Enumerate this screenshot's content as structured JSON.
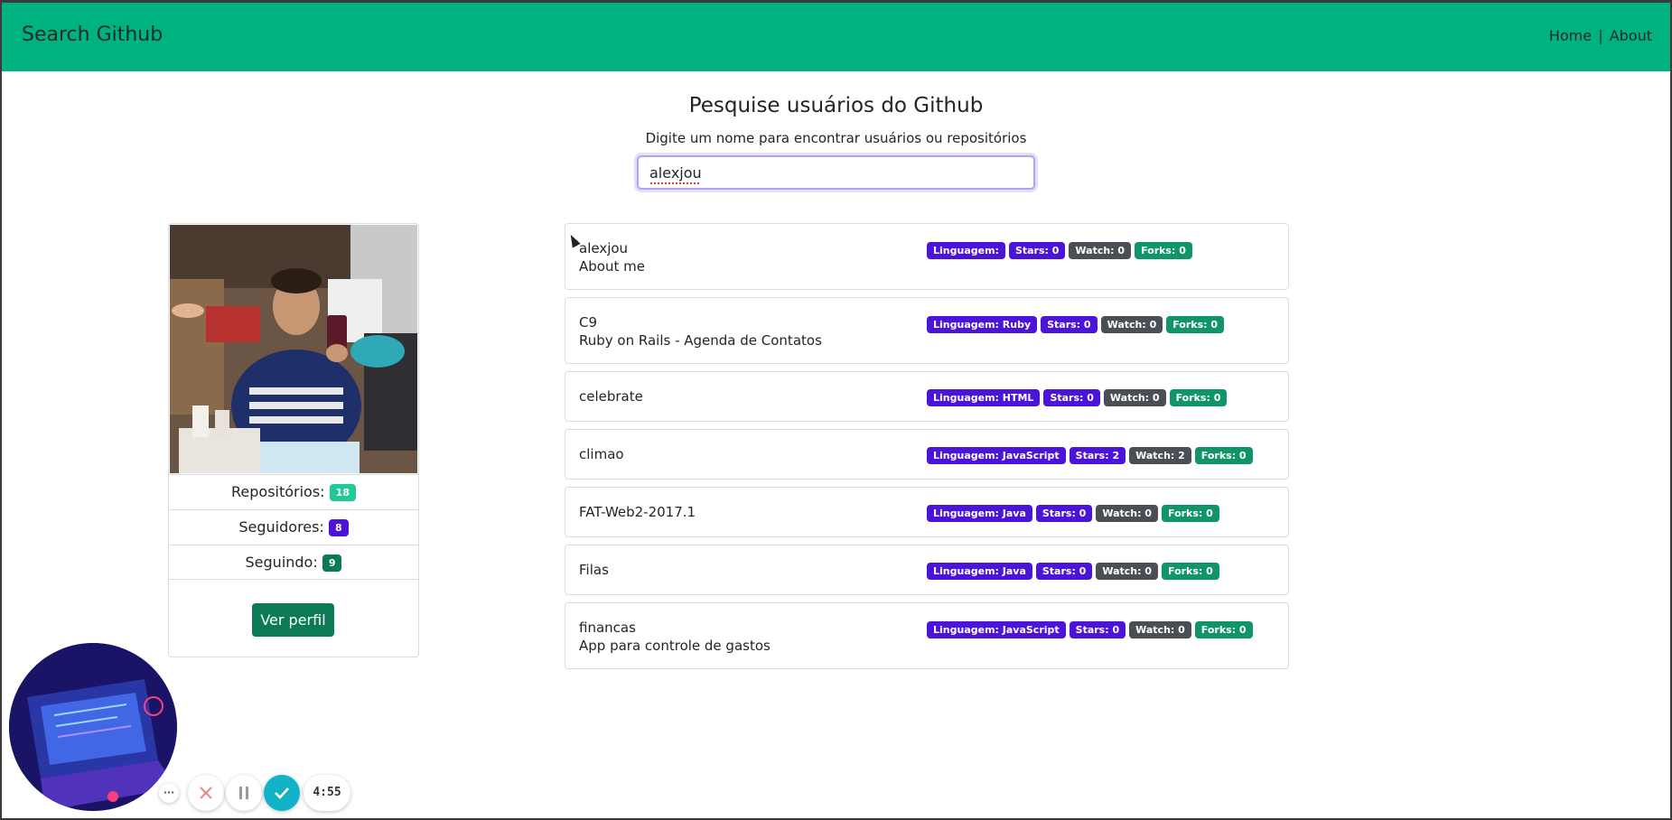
{
  "navbar": {
    "brand": "Search Github",
    "links": [
      "Home",
      "About"
    ],
    "separator": "|",
    "color": "#00b27f"
  },
  "search": {
    "title": "Pesquise usuários do Github",
    "subtitle": "Digite um nome para encontrar usuários ou repositórios",
    "value": "alexjou"
  },
  "profile": {
    "stats": [
      {
        "label": "Repositórios:",
        "value": "18",
        "color": "#20c997"
      },
      {
        "label": "Seguidores:",
        "value": "8",
        "color": "#4b14d8"
      },
      {
        "label": "Seguindo:",
        "value": "9",
        "color": "#0b7a55"
      }
    ],
    "button_label": "Ver perfil"
  },
  "repos": [
    {
      "name": "alexjou",
      "description": "About me",
      "language": "Linguagem:",
      "stars": "Stars: 0",
      "watch": "Watch: 0",
      "forks": "Forks: 0"
    },
    {
      "name": "C9",
      "description": "Ruby on Rails - Agenda de Contatos",
      "language": "Linguagem: Ruby",
      "stars": "Stars: 0",
      "watch": "Watch: 0",
      "forks": "Forks: 0"
    },
    {
      "name": "celebrate",
      "description": "",
      "language": "Linguagem: HTML",
      "stars": "Stars: 0",
      "watch": "Watch: 0",
      "forks": "Forks: 0"
    },
    {
      "name": "climao",
      "description": "",
      "language": "Linguagem: JavaScript",
      "stars": "Stars: 2",
      "watch": "Watch: 2",
      "forks": "Forks: 0"
    },
    {
      "name": "FAT-Web2-2017.1",
      "description": "",
      "language": "Linguagem: Java",
      "stars": "Stars: 0",
      "watch": "Watch: 0",
      "forks": "Forks: 0"
    },
    {
      "name": "Filas",
      "description": "",
      "language": "Linguagem: Java",
      "stars": "Stars: 0",
      "watch": "Watch: 0",
      "forks": "Forks: 0"
    },
    {
      "name": "financas",
      "description": "App para controle de gastos",
      "language": "Linguagem: JavaScript",
      "stars": "Stars: 0",
      "watch": "Watch: 0",
      "forks": "Forks: 0"
    }
  ],
  "recorder": {
    "timer": "4:55",
    "more_glyph": "···"
  },
  "colors": {
    "badge_language": "#4b14d8",
    "badge_stars": "#4b14d8",
    "badge_watch": "#4a4f55",
    "badge_forks": "#10956a"
  },
  "icons": [
    "more-icon",
    "close-icon",
    "pause-icon",
    "check-icon"
  ]
}
